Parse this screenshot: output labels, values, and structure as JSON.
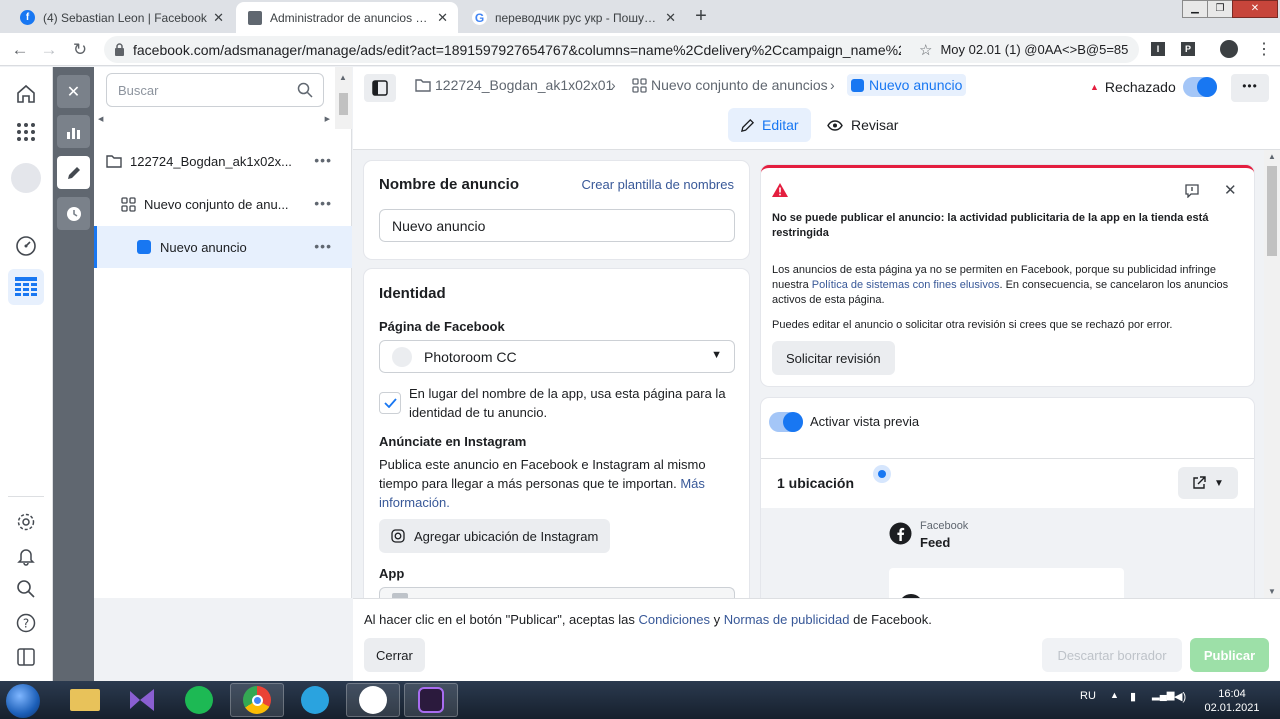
{
  "browser": {
    "tabs": [
      {
        "title": "(4) Sebastian Leon | Facebook",
        "fav_color": "#1877f2",
        "fav_letter": "f"
      },
      {
        "title": "Administrador de anuncios - Administrador",
        "fav_color": "#606770",
        "fav_letter": ""
      },
      {
        "title": "переводчик рус укр - Пошук Google",
        "fav_color": "#ffffff",
        "fav_letter": "G"
      }
    ],
    "url": "facebook.com/adsmanager/manage/ads/edit?act=1891597927654767&columns=name%2Cdelivery%2Ccampaign_name%2Cbid%...",
    "bookmark_text": "Moy 02.01 (1) @0AA<>B@5=85",
    "ext1": "I",
    "ext2": "P"
  },
  "tree": {
    "search_placeholder": "Buscar",
    "items": [
      {
        "label": "122724_Bogdan_ak1x02x..."
      },
      {
        "label": "Nuevo conjunto de anu..."
      },
      {
        "label": "Nuevo anuncio"
      }
    ]
  },
  "breadcrumb": {
    "campaign": "122724_Bogdan_ak1x02x01",
    "adset": "Nuevo conjunto de anuncios",
    "ad": "Nuevo anuncio",
    "status": "Rechazado"
  },
  "mode": {
    "edit": "Editar",
    "review": "Revisar"
  },
  "ad_name": {
    "title": "Nombre de anuncio",
    "template_link": "Crear plantilla de nombres",
    "value": "Nuevo anuncio"
  },
  "identity": {
    "title": "Identidad",
    "fb_page_label": "Página de Facebook",
    "fb_page_value": "Photoroom CC",
    "checkbox_text": "En lugar del nombre de la app, usa esta página para la identidad de tu anuncio.",
    "instagram_title": "Anúnciate en Instagram",
    "instagram_desc": "Publica este anuncio en Facebook e Instagram al mismo tiempo para llegar a más personas que te importan.",
    "instagram_more": "Más información.",
    "instagram_button": "Agregar ubicación de Instagram",
    "app_label": "App"
  },
  "alert": {
    "title": "No se puede publicar el anuncio: la actividad publicitaria de la app en la tienda está restringida",
    "body_part1": "Los anuncios de esta página ya no se permiten en Facebook, porque su publicidad infringe nuestra",
    "body_link": "Política de sistemas con fines elusivos",
    "body_part2": ". En consecuencia, se cancelaron los anuncios activos de esta página.",
    "body2": "Puedes editar el anuncio o solicitar otra revisión si crees que se rechazó por error.",
    "button": "Solicitar revisión",
    "color": "#e41e3f"
  },
  "preview": {
    "toggle_label": "Activar vista previa",
    "placements_title": "1 ubicación",
    "platform": "Facebook",
    "placement": "Feed"
  },
  "footer": {
    "terms_part1": "Al hacer clic en el botón \"Publicar\", aceptas las",
    "terms_link1": "Condiciones",
    "terms_and": "y",
    "terms_link2": "Normas de publicidad",
    "terms_part2": "de Facebook.",
    "close": "Cerrar",
    "discard": "Descartar borrador",
    "publish": "Publicar"
  },
  "taskbar": {
    "lang": "RU",
    "time": "16:04",
    "date": "02.01.2021"
  },
  "colors": {
    "accent": "#1877f2",
    "publish_disabled": "#9de0a8"
  }
}
